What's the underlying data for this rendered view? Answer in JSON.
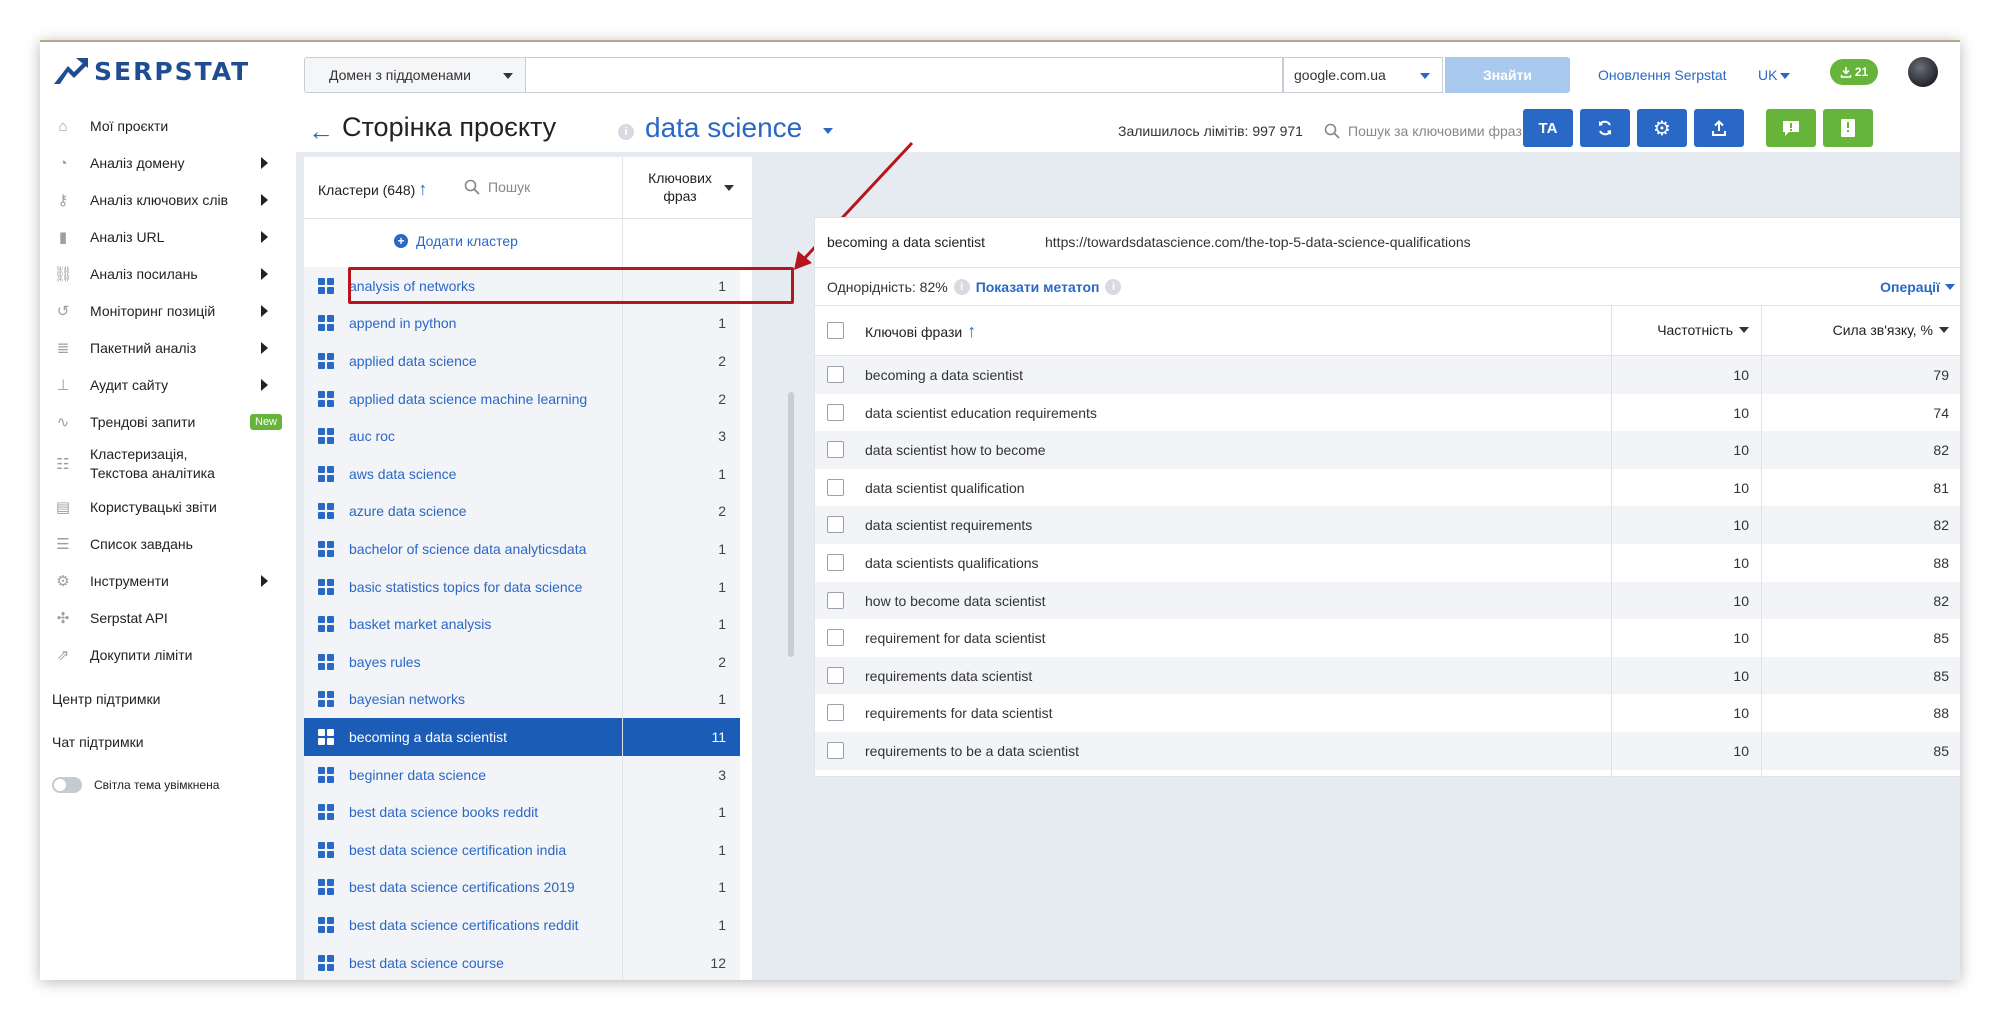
{
  "app": {
    "logo_text": "SERPSTAT"
  },
  "topbar": {
    "domain_select": "Домен з піддоменами",
    "search_value": "",
    "engine_select": "google.com.ua",
    "find_button": "Знайти",
    "updates_link": "Оновлення Serpstat",
    "language": "UK",
    "download_count": "21"
  },
  "sidebar": {
    "items": [
      {
        "label": "Мої проєкти",
        "icon": "home-icon",
        "arrow": false
      },
      {
        "label": "Аналіз домену",
        "icon": "domain-analysis-icon",
        "arrow": true
      },
      {
        "label": "Аналіз ключових слів",
        "icon": "key-icon",
        "arrow": true
      },
      {
        "label": "Аналіз URL",
        "icon": "bar-chart-icon",
        "arrow": true
      },
      {
        "label": "Аналіз посилань",
        "icon": "link-icon",
        "arrow": true
      },
      {
        "label": "Моніторинг позицій",
        "icon": "history-icon",
        "arrow": true
      },
      {
        "label": "Пакетний аналіз",
        "icon": "database-icon",
        "arrow": true
      },
      {
        "label": "Аудит сайту",
        "icon": "sitemap-icon",
        "arrow": true
      },
      {
        "label": "Трендові запити",
        "icon": "trend-icon",
        "arrow": false,
        "badge": "New"
      },
      {
        "label": "Кластеризація,\nТекстова аналітика",
        "icon": "clustering-icon",
        "arrow": false
      },
      {
        "label": "Користувацькі звіти",
        "icon": "report-icon",
        "arrow": false
      },
      {
        "label": "Список завдань",
        "icon": "checklist-icon",
        "arrow": false
      },
      {
        "label": "Інструменти",
        "icon": "gear-icon",
        "arrow": true
      },
      {
        "label": "Serpstat API",
        "icon": "api-icon",
        "arrow": false
      },
      {
        "label": "Докупити ліміти",
        "icon": "cart-icon",
        "arrow": false
      }
    ],
    "support_center": "Центр підтримки",
    "support_chat": "Чат підтримки",
    "theme_toggle": "Світла тема увімкнена"
  },
  "header": {
    "page_title": "Сторінка проєкту",
    "project_name": "data science",
    "limits": "Залишилось лімітів: 997 971",
    "keyword_search_placeholder": "Пошук за ключовими фраз...",
    "ta_button": "TA"
  },
  "clusters": {
    "title": "Кластери (648)",
    "search_placeholder": "Пошук",
    "count_header": "Ключових фраз",
    "add_cluster": "Додати кластер",
    "rows": [
      {
        "name": "analysis of networks",
        "count": "1"
      },
      {
        "name": "append in python",
        "count": "1"
      },
      {
        "name": "applied data science",
        "count": "2"
      },
      {
        "name": "applied data science machine learning",
        "count": "2"
      },
      {
        "name": "auc roc",
        "count": "3"
      },
      {
        "name": "aws data science",
        "count": "1"
      },
      {
        "name": "azure data science",
        "count": "2"
      },
      {
        "name": "bachelor of science data analyticsdata",
        "count": "1"
      },
      {
        "name": "basic statistics topics for data science",
        "count": "1"
      },
      {
        "name": "basket market analysis",
        "count": "1"
      },
      {
        "name": "bayes rules",
        "count": "2"
      },
      {
        "name": "bayesian networks",
        "count": "1"
      },
      {
        "name": "becoming a data scientist",
        "count": "11",
        "selected": true
      },
      {
        "name": "beginner data science",
        "count": "3"
      },
      {
        "name": "best data science books reddit",
        "count": "1"
      },
      {
        "name": "best data science certification india",
        "count": "1"
      },
      {
        "name": "best data science certifications 2019",
        "count": "1"
      },
      {
        "name": "best data science certifications reddit",
        "count": "1"
      },
      {
        "name": "best data science course",
        "count": "12"
      }
    ]
  },
  "detail": {
    "cluster_title": "becoming a data scientist",
    "cluster_url": "https://towardsdatascience.com/the-top-5-data-science-qualifications",
    "homogeneity": "Однорідність: 82%",
    "show_metatop": "Показати метатоп",
    "operations": "Операції",
    "col_phrases": "Ключові фрази",
    "col_frequency": "Частотність",
    "col_strength": "Сила зв'язку, %",
    "rows": [
      {
        "phrase": "becoming a data scientist",
        "freq": "10",
        "strength": "79"
      },
      {
        "phrase": "data scientist education requirements",
        "freq": "10",
        "strength": "74"
      },
      {
        "phrase": "data scientist how to become",
        "freq": "10",
        "strength": "82"
      },
      {
        "phrase": "data scientist qualification",
        "freq": "10",
        "strength": "81"
      },
      {
        "phrase": "data scientist requirements",
        "freq": "10",
        "strength": "82"
      },
      {
        "phrase": "data scientists qualifications",
        "freq": "10",
        "strength": "88"
      },
      {
        "phrase": "how to become data scientist",
        "freq": "10",
        "strength": "82"
      },
      {
        "phrase": "requirement for data scientist",
        "freq": "10",
        "strength": "85"
      },
      {
        "phrase": "requirements data scientist",
        "freq": "10",
        "strength": "85"
      },
      {
        "phrase": "requirements for data scientist",
        "freq": "10",
        "strength": "88"
      },
      {
        "phrase": "requirements to be a data scientist",
        "freq": "10",
        "strength": "85"
      }
    ]
  },
  "colors": {
    "brand_blue": "#2a68c6",
    "selected_row": "#1b5cb7",
    "green": "#66b53a",
    "highlight_red": "#b8141b"
  }
}
